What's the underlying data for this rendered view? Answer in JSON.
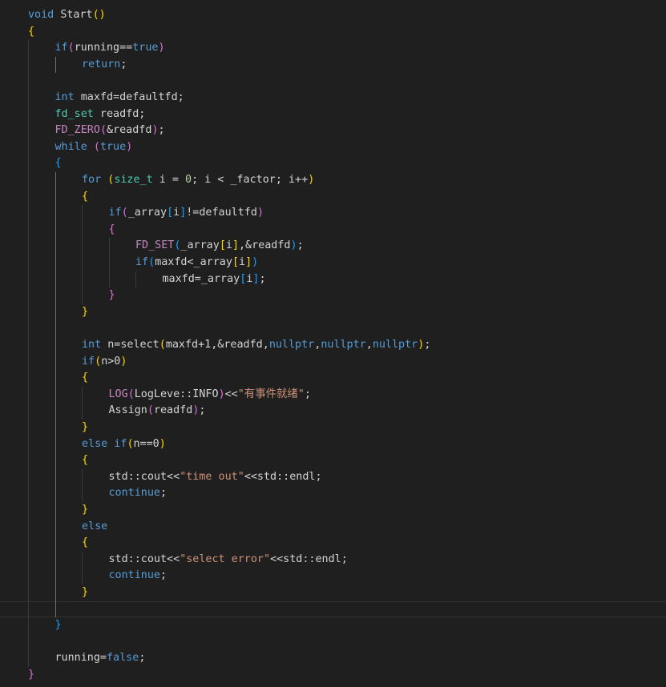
{
  "editor": {
    "language": "cpp",
    "theme_colors": {
      "background": "#1f1f1f",
      "keyword": "#569cd6",
      "control": "#c586c0",
      "identifier": "#d4d4d4",
      "function": "#dcdcaa",
      "type": "#4ec9b0",
      "string": "#ce9178",
      "bracket_level_1": "#ffd700",
      "bracket_level_2": "#da70d6",
      "bracket_level_3": "#179fff"
    },
    "current_line": 36,
    "lines": [
      {
        "indent": 0,
        "tokens": [
          {
            "t": "void",
            "c": "kw"
          },
          {
            "t": " ",
            "c": "id"
          },
          {
            "t": "Start",
            "c": "id"
          },
          {
            "t": "()",
            "c": "b1"
          }
        ]
      },
      {
        "indent": 0,
        "tokens": [
          {
            "t": "{",
            "c": "b1"
          }
        ]
      },
      {
        "indent": 1,
        "tokens": [
          {
            "t": "if",
            "c": "kw"
          },
          {
            "t": "(",
            "c": "b2"
          },
          {
            "t": "running==",
            "c": "id"
          },
          {
            "t": "true",
            "c": "kw"
          },
          {
            "t": ")",
            "c": "b2"
          }
        ]
      },
      {
        "indent": 2,
        "tokens": [
          {
            "t": "return",
            "c": "kw"
          },
          {
            "t": ";",
            "c": "id"
          }
        ]
      },
      {
        "indent": 1,
        "tokens": []
      },
      {
        "indent": 1,
        "tokens": [
          {
            "t": "int",
            "c": "kw"
          },
          {
            "t": " maxfd=defaultfd;",
            "c": "id"
          }
        ]
      },
      {
        "indent": 1,
        "tokens": [
          {
            "t": "fd_set",
            "c": "type"
          },
          {
            "t": " readfd;",
            "c": "id"
          }
        ]
      },
      {
        "indent": 1,
        "tokens": [
          {
            "t": "FD_ZERO",
            "c": "macro"
          },
          {
            "t": "(",
            "c": "b2"
          },
          {
            "t": "&readfd",
            "c": "id"
          },
          {
            "t": ")",
            "c": "b2"
          },
          {
            "t": ";",
            "c": "id"
          }
        ]
      },
      {
        "indent": 1,
        "tokens": [
          {
            "t": "while",
            "c": "kw"
          },
          {
            "t": " ",
            "c": "id"
          },
          {
            "t": "(",
            "c": "b2"
          },
          {
            "t": "true",
            "c": "kw"
          },
          {
            "t": ")",
            "c": "b2"
          }
        ]
      },
      {
        "indent": 1,
        "tokens": [
          {
            "t": "{",
            "c": "b3"
          }
        ]
      },
      {
        "indent": 2,
        "tokens": [
          {
            "t": "for",
            "c": "kw"
          },
          {
            "t": " ",
            "c": "id"
          },
          {
            "t": "(",
            "c": "b1"
          },
          {
            "t": "size_t",
            "c": "type"
          },
          {
            "t": " i = ",
            "c": "id"
          },
          {
            "t": "0",
            "c": "num"
          },
          {
            "t": "; i < _factor; i++",
            "c": "id"
          },
          {
            "t": ")",
            "c": "b1"
          }
        ]
      },
      {
        "indent": 2,
        "tokens": [
          {
            "t": "{",
            "c": "b1"
          }
        ]
      },
      {
        "indent": 3,
        "tokens": [
          {
            "t": "if",
            "c": "kw"
          },
          {
            "t": "(",
            "c": "b2"
          },
          {
            "t": "_array",
            "c": "id"
          },
          {
            "t": "[",
            "c": "b3"
          },
          {
            "t": "i",
            "c": "id"
          },
          {
            "t": "]",
            "c": "b3"
          },
          {
            "t": "!=defaultfd",
            "c": "id"
          },
          {
            "t": ")",
            "c": "b2"
          }
        ]
      },
      {
        "indent": 3,
        "tokens": [
          {
            "t": "{",
            "c": "b2"
          }
        ]
      },
      {
        "indent": 4,
        "tokens": [
          {
            "t": "FD_SET",
            "c": "macro"
          },
          {
            "t": "(",
            "c": "b3"
          },
          {
            "t": "_array",
            "c": "id"
          },
          {
            "t": "[",
            "c": "b1"
          },
          {
            "t": "i",
            "c": "id"
          },
          {
            "t": "]",
            "c": "b1"
          },
          {
            "t": ",&readfd",
            "c": "id"
          },
          {
            "t": ")",
            "c": "b3"
          },
          {
            "t": ";",
            "c": "id"
          }
        ]
      },
      {
        "indent": 4,
        "tokens": [
          {
            "t": "if",
            "c": "kw"
          },
          {
            "t": "(",
            "c": "b3"
          },
          {
            "t": "maxfd<_array",
            "c": "id"
          },
          {
            "t": "[",
            "c": "b1"
          },
          {
            "t": "i",
            "c": "id"
          },
          {
            "t": "]",
            "c": "b1"
          },
          {
            "t": ")",
            "c": "b3"
          }
        ]
      },
      {
        "indent": 5,
        "tokens": [
          {
            "t": "maxfd=_array",
            "c": "id"
          },
          {
            "t": "[",
            "c": "b3"
          },
          {
            "t": "i",
            "c": "id"
          },
          {
            "t": "]",
            "c": "b3"
          },
          {
            "t": ";",
            "c": "id"
          }
        ]
      },
      {
        "indent": 3,
        "tokens": [
          {
            "t": "}",
            "c": "b2"
          }
        ]
      },
      {
        "indent": 2,
        "tokens": [
          {
            "t": "}",
            "c": "b1"
          }
        ]
      },
      {
        "indent": 2,
        "tokens": []
      },
      {
        "indent": 2,
        "tokens": [
          {
            "t": "int",
            "c": "kw"
          },
          {
            "t": " n=select",
            "c": "id"
          },
          {
            "t": "(",
            "c": "b1"
          },
          {
            "t": "maxfd+1,&readfd,",
            "c": "id"
          },
          {
            "t": "nullptr",
            "c": "kw"
          },
          {
            "t": ",",
            "c": "id"
          },
          {
            "t": "nullptr",
            "c": "kw"
          },
          {
            "t": ",",
            "c": "id"
          },
          {
            "t": "nullptr",
            "c": "kw"
          },
          {
            "t": ")",
            "c": "b1"
          },
          {
            "t": ";",
            "c": "id"
          }
        ]
      },
      {
        "indent": 2,
        "tokens": [
          {
            "t": "if",
            "c": "kw"
          },
          {
            "t": "(",
            "c": "b1"
          },
          {
            "t": "n>0",
            "c": "id"
          },
          {
            "t": ")",
            "c": "b1"
          }
        ]
      },
      {
        "indent": 2,
        "tokens": [
          {
            "t": "{",
            "c": "b1"
          }
        ]
      },
      {
        "indent": 3,
        "tokens": [
          {
            "t": "LOG",
            "c": "macro"
          },
          {
            "t": "(",
            "c": "b2"
          },
          {
            "t": "LogLeve::INFO",
            "c": "id"
          },
          {
            "t": ")",
            "c": "b2"
          },
          {
            "t": "<<",
            "c": "id"
          },
          {
            "t": "\"有事件就绪\"",
            "c": "str"
          },
          {
            "t": ";",
            "c": "id"
          }
        ]
      },
      {
        "indent": 3,
        "tokens": [
          {
            "t": "Assign",
            "c": "id"
          },
          {
            "t": "(",
            "c": "b2"
          },
          {
            "t": "readfd",
            "c": "id"
          },
          {
            "t": ")",
            "c": "b2"
          },
          {
            "t": ";",
            "c": "id"
          }
        ]
      },
      {
        "indent": 2,
        "tokens": [
          {
            "t": "}",
            "c": "b1"
          }
        ]
      },
      {
        "indent": 2,
        "tokens": [
          {
            "t": "else if",
            "c": "kw"
          },
          {
            "t": "(",
            "c": "b1"
          },
          {
            "t": "n==0",
            "c": "id"
          },
          {
            "t": ")",
            "c": "b1"
          }
        ]
      },
      {
        "indent": 2,
        "tokens": [
          {
            "t": "{",
            "c": "b1"
          }
        ]
      },
      {
        "indent": 3,
        "tokens": [
          {
            "t": "std::cout<<",
            "c": "id"
          },
          {
            "t": "\"time out\"",
            "c": "str"
          },
          {
            "t": "<<std::endl;",
            "c": "id"
          }
        ]
      },
      {
        "indent": 3,
        "tokens": [
          {
            "t": "continue",
            "c": "kw"
          },
          {
            "t": ";",
            "c": "id"
          }
        ]
      },
      {
        "indent": 2,
        "tokens": [
          {
            "t": "}",
            "c": "b1"
          }
        ]
      },
      {
        "indent": 2,
        "tokens": [
          {
            "t": "else",
            "c": "kw"
          }
        ]
      },
      {
        "indent": 2,
        "tokens": [
          {
            "t": "{",
            "c": "b1"
          }
        ]
      },
      {
        "indent": 3,
        "tokens": [
          {
            "t": "std::cout<<",
            "c": "id"
          },
          {
            "t": "\"select error\"",
            "c": "str"
          },
          {
            "t": "<<std::endl;",
            "c": "id"
          }
        ]
      },
      {
        "indent": 3,
        "tokens": [
          {
            "t": "continue",
            "c": "kw"
          },
          {
            "t": ";",
            "c": "id"
          }
        ]
      },
      {
        "indent": 2,
        "tokens": [
          {
            "t": "}",
            "c": "b1"
          }
        ]
      },
      {
        "indent": 2,
        "tokens": []
      },
      {
        "indent": 1,
        "tokens": [
          {
            "t": "}",
            "c": "b3"
          }
        ]
      },
      {
        "indent": 1,
        "tokens": []
      },
      {
        "indent": 1,
        "tokens": [
          {
            "t": "running=",
            "c": "id"
          },
          {
            "t": "false",
            "c": "kw"
          },
          {
            "t": ";",
            "c": "id"
          }
        ]
      },
      {
        "indent": 0,
        "tokens": [
          {
            "t": "}",
            "c": "b2"
          }
        ]
      }
    ]
  }
}
